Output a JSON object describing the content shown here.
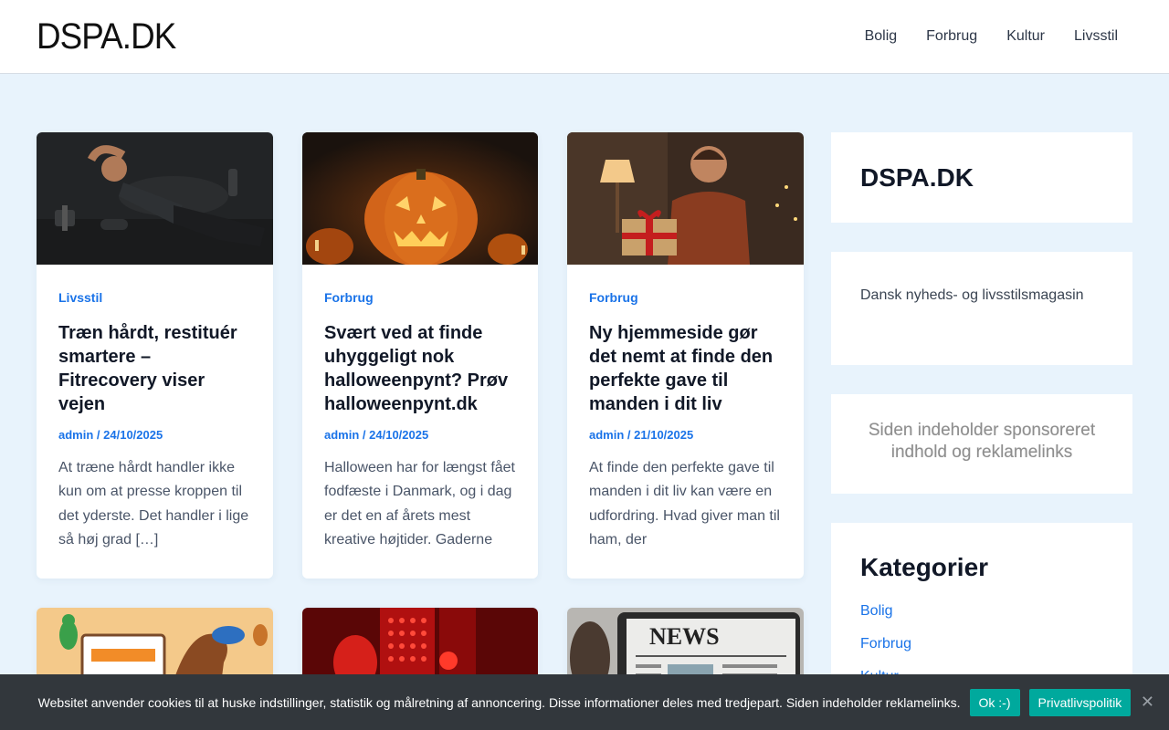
{
  "header": {
    "logo": "DSPA.DK",
    "nav": [
      "Bolig",
      "Forbrug",
      "Kultur",
      "Livsstil"
    ]
  },
  "posts": [
    {
      "category": "Livsstil",
      "title": "Træn hårdt, restituér smartere – Fitrecovery viser vejen",
      "author": "admin",
      "date": "24/10/2025",
      "excerpt": "At træne hårdt handler ikke kun om at presse kroppen til det yderste. Det handler i lige så høj grad […]",
      "image": "man-exercising-photo"
    },
    {
      "category": "Forbrug",
      "title": "Svært ved at finde uhyggeligt nok halloweenpynt? Prøv halloweenpynt.dk",
      "author": "admin",
      "date": "24/10/2025",
      "excerpt": "Halloween har for længst fået fodfæste i Danmark, og i dag er det en af årets mest kreative højtider. Gaderne",
      "image": "halloween-pumpkins-photo"
    },
    {
      "category": "Forbrug",
      "title": "Ny hjemmeside gør det nemt at finde den perfekte gave til manden i dit liv",
      "author": "admin",
      "date": "21/10/2025",
      "excerpt": "At finde den perfekte gave til manden i dit liv kan være en udfordring. Hvad giver man til ham, der",
      "image": "man-receiving-gift-photo"
    },
    {
      "image": "pets-illustration"
    },
    {
      "image": "red-light-therapy-photo"
    },
    {
      "image": "newspaper-tablet-photo"
    }
  ],
  "sidebar": {
    "site_title": "DSPA.DK",
    "tagline": "Dansk nyheds- og livsstilsmagasin",
    "sponsor_line1": "Siden indeholder sponsoreret",
    "sponsor_line2": "indhold og reklamelinks",
    "categories_title": "Kategorier",
    "categories": [
      "Bolig",
      "Forbrug",
      "Kultur"
    ]
  },
  "cookie": {
    "text": "Websitet anvender cookies til at huske indstillinger, statistik og målretning af annoncering. Disse informationer deles med tredjepart. Siden indeholder reklamelinks.",
    "ok_label": "Ok :-)",
    "privacy_label": "Privatlivspolitik",
    "close_glyph": "✕"
  },
  "colors": {
    "accent": "#1a73e8",
    "background": "#e8f3fc",
    "cookie_bg": "#32373c",
    "cookie_btn": "#00a99d"
  }
}
